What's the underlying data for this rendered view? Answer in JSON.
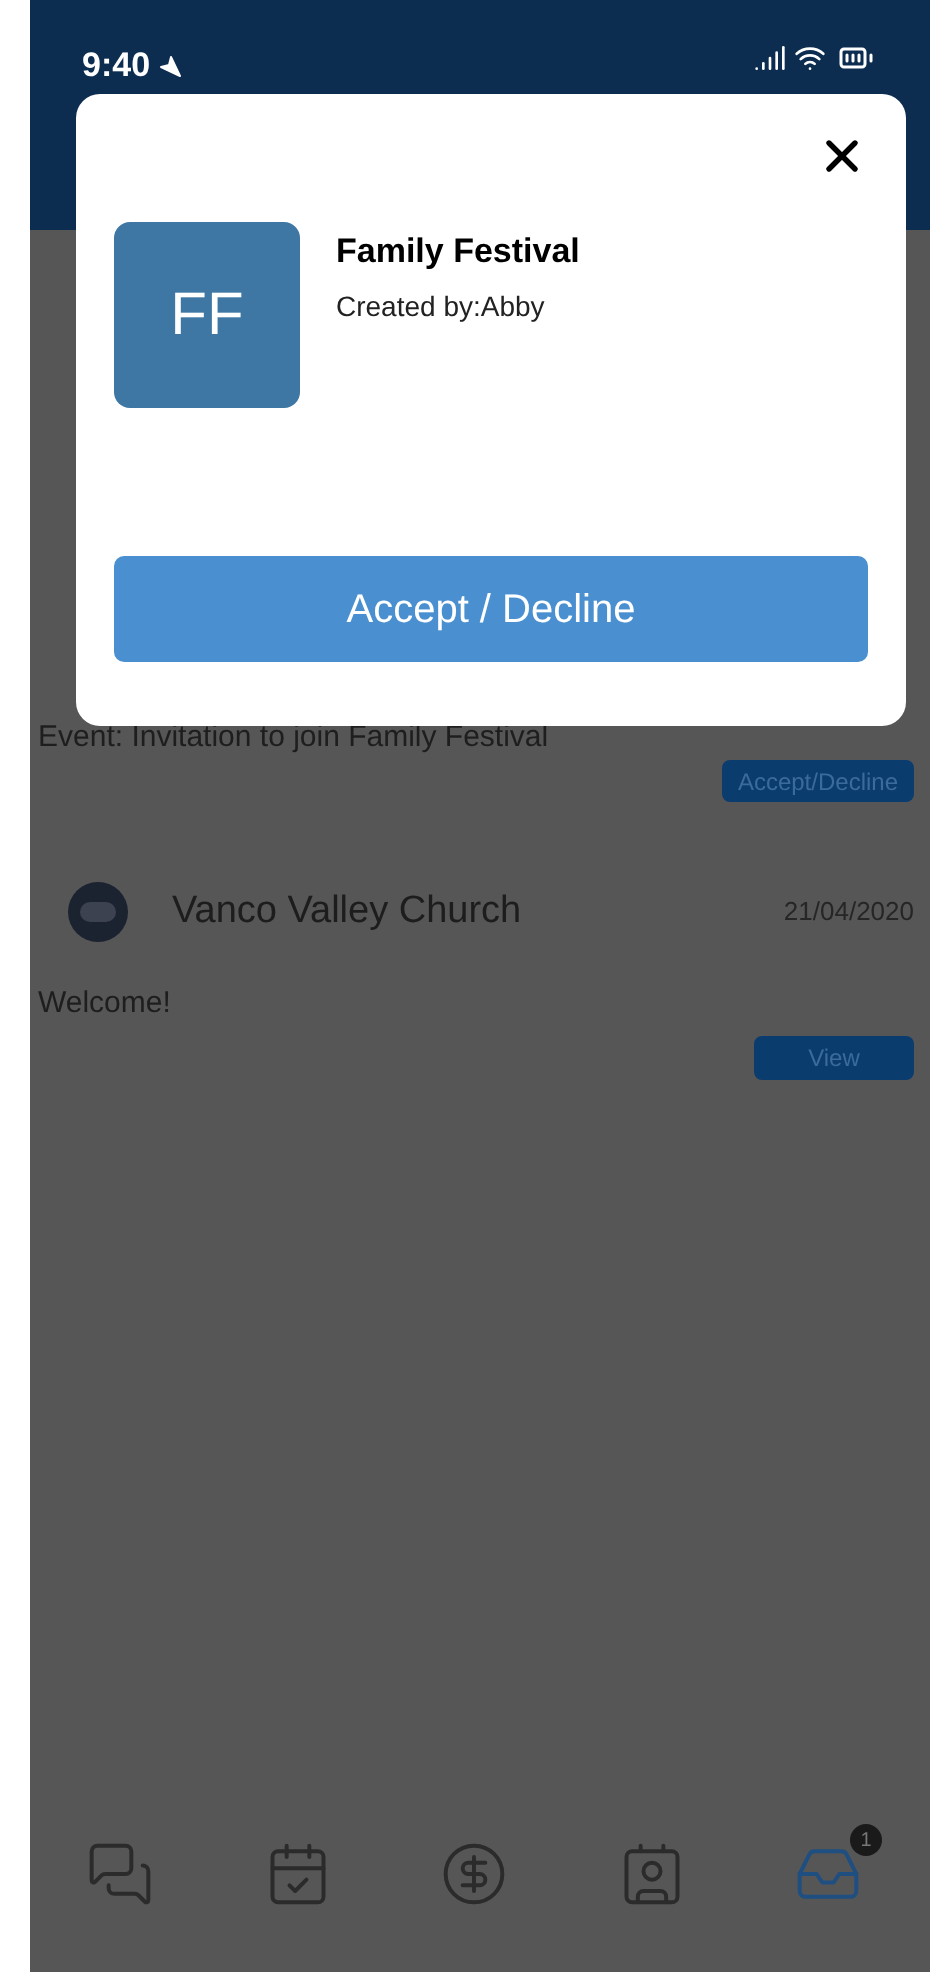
{
  "status_bar": {
    "time": "9:40"
  },
  "modal": {
    "avatar_initials": "FF",
    "title": "Family Festival",
    "subtitle": "Created by:Abby",
    "button": "Accept / Decline"
  },
  "messages": [
    {
      "kind": "event",
      "text": "Event: Invitation to join Family Festival",
      "button": "Accept/Decline"
    },
    {
      "kind": "message",
      "sender": "Vanco Valley Church",
      "date": "21/04/2020",
      "text": "Welcome!",
      "button": "View"
    }
  ],
  "tabs": [
    {
      "kind": "chat",
      "selected": false
    },
    {
      "kind": "calendar",
      "selected": false
    },
    {
      "kind": "giving",
      "selected": false
    },
    {
      "kind": "contacts",
      "selected": false
    },
    {
      "kind": "inbox",
      "selected": true,
      "badge": "1"
    }
  ]
}
